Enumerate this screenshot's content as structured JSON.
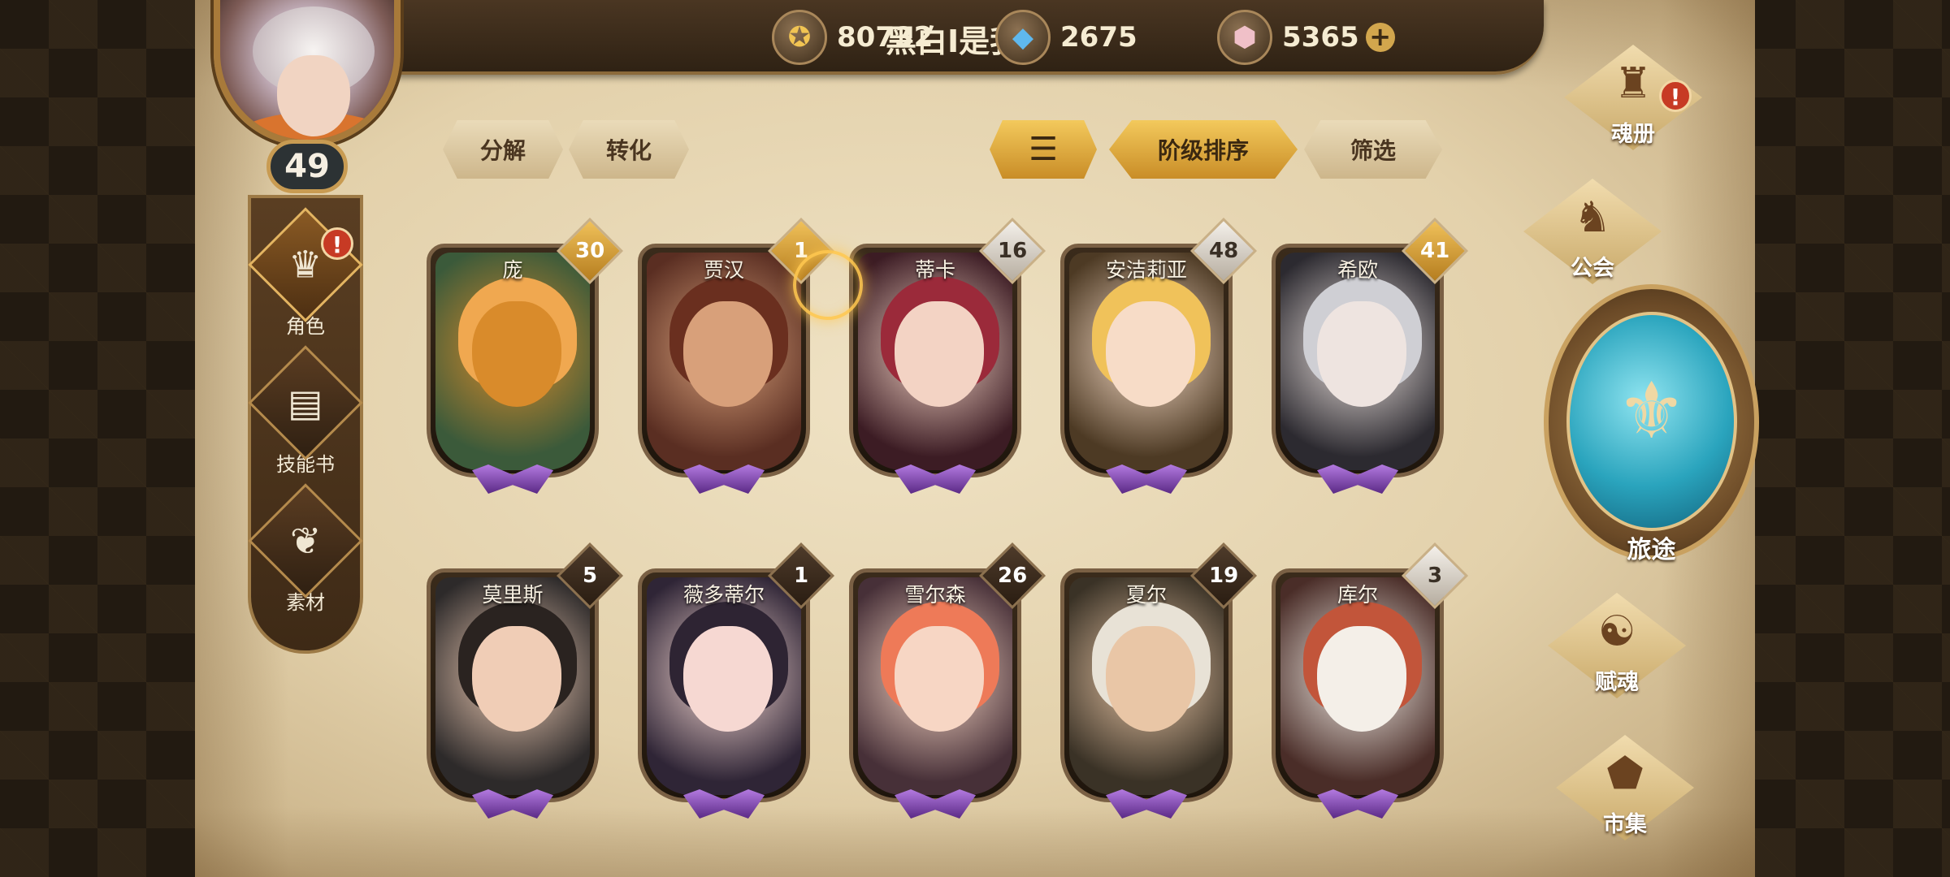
{
  "header": {
    "player_name": "黑白I是我",
    "level": "49",
    "resources": [
      {
        "icon": "gold-coin-icon",
        "value": "80732"
      },
      {
        "icon": "blue-crystal-icon",
        "value": "2675"
      },
      {
        "icon": "pink-gem-icon",
        "value": "5365"
      }
    ]
  },
  "left_menu": [
    {
      "label": "角色",
      "icon": "character-icon",
      "alert": "!"
    },
    {
      "label": "技能书",
      "icon": "skill-book-icon"
    },
    {
      "label": "素材",
      "icon": "material-icon"
    }
  ],
  "toolbar": {
    "decompose": "分解",
    "convert": "转化",
    "sort_order": "阶级排序",
    "filter": "筛选"
  },
  "heroes": [
    {
      "name": "庞",
      "count": "30",
      "badge": "gold"
    },
    {
      "name": "贾汉",
      "count": "1",
      "badge": "gold"
    },
    {
      "name": "蒂卡",
      "count": "16",
      "badge": "silver"
    },
    {
      "name": "安洁莉亚",
      "count": "48",
      "badge": "silver"
    },
    {
      "name": "希欧",
      "count": "41",
      "badge": "gold"
    },
    {
      "name": "莫里斯",
      "count": "5",
      "badge": "dark"
    },
    {
      "name": "薇多蒂尔",
      "count": "1",
      "badge": "dark"
    },
    {
      "name": "雪尔森",
      "count": "26",
      "badge": "dark"
    },
    {
      "name": "夏尔",
      "count": "19",
      "badge": "dark"
    },
    {
      "name": "库尔",
      "count": "3",
      "badge": "silver"
    }
  ],
  "right_menu": {
    "soul_book": "魂册",
    "soul_book_alert": "!",
    "guild": "公会",
    "journey": "旅途",
    "endow_soul": "赋魂",
    "market": "市集"
  },
  "colors": {
    "parchment": "#e6d5b0",
    "gold_accent": "#d9a744",
    "journey_teal": "#2aa4bd",
    "gem_purple": "#8a4cc2"
  }
}
